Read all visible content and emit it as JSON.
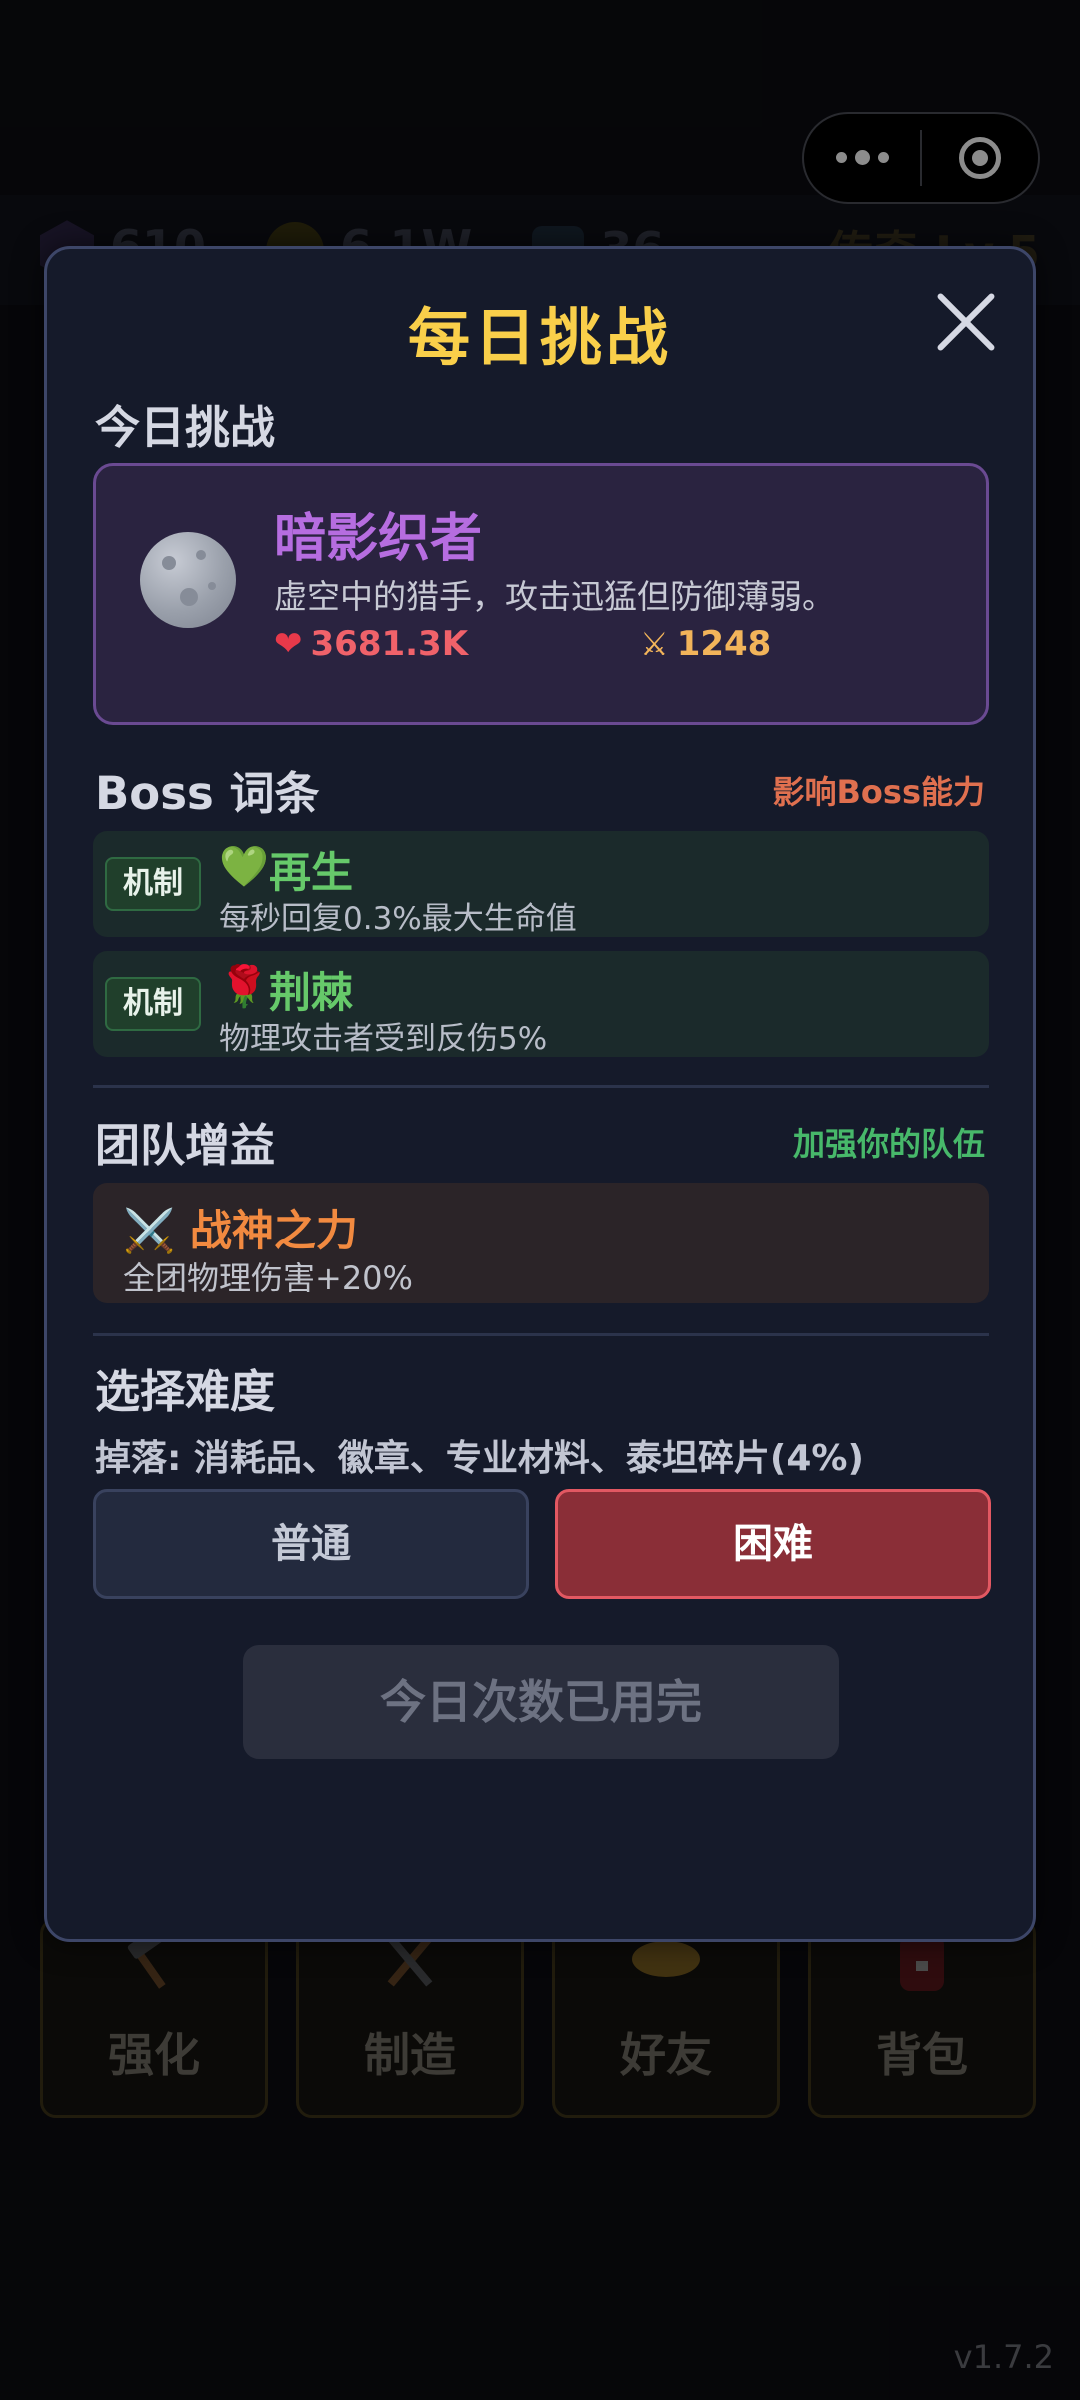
{
  "background": {
    "status_bar": {
      "gems": "610",
      "coins": "6.1W",
      "potions": "36",
      "title": "传奇 Lv.5"
    },
    "nav": [
      {
        "label": "强化",
        "icon": "hammer-icon"
      },
      {
        "label": "制造",
        "icon": "tools-icon"
      },
      {
        "label": "好友",
        "icon": "handshake-icon"
      },
      {
        "label": "背包",
        "icon": "backpack-icon"
      }
    ],
    "version": "v1.7.2"
  },
  "dialog": {
    "title": "每日挑战",
    "today_label": "今日挑战",
    "boss": {
      "name": "暗影织者",
      "description": "虚空中的猎手，攻击迅猛但防御薄弱。",
      "hp": "3681.3K",
      "attack": "1248",
      "icon": "moon-icon"
    },
    "affix_section": {
      "label": "Boss 词条",
      "hint": "影响Boss能力"
    },
    "affixes": [
      {
        "tag": "机制",
        "icon": "💚",
        "name": "再生",
        "desc": "每秒回复0.3%最大生命值"
      },
      {
        "tag": "机制",
        "icon": "🌹",
        "name": "荆棘",
        "desc": "物理攻击者受到反伤5%"
      }
    ],
    "buff_section": {
      "label": "团队增益",
      "hint": "加强你的队伍"
    },
    "buff": {
      "icon": "⚔️",
      "name": "战神之力",
      "desc": "全团物理伤害+20%"
    },
    "difficulty_section": {
      "label": "选择难度",
      "drops": "掉落: 消耗品、徽章、专业材料、泰坦碎片(4%)",
      "options": [
        "普通",
        "困难"
      ],
      "selected": "困难"
    },
    "action_button": "今日次数已用完"
  },
  "colors": {
    "title": "#f9cf4a",
    "boss_name": "#b66de0",
    "hp": "#f0626a",
    "attack": "#f2b45a",
    "affix_name": "#66c96a",
    "buff_name": "#f28a40",
    "affix_hint": "#e0704f",
    "buff_hint": "#47b86a",
    "hard_button": "#8a2e37"
  }
}
